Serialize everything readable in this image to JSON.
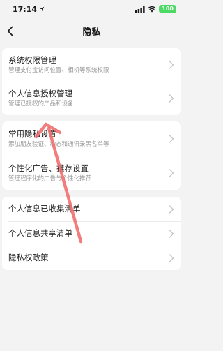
{
  "status_bar": {
    "time": "17:14",
    "battery": "100"
  },
  "nav": {
    "title": "隐私"
  },
  "sections": [
    {
      "items": [
        {
          "title": "系统权限管理",
          "subtitle": "管理支付宝访问位置、相机等系统权限"
        },
        {
          "title": "个人信息授权管理",
          "subtitle": "管理已授权的产品和设备"
        }
      ]
    },
    {
      "items": [
        {
          "title": "常用隐私设置",
          "subtitle": "添加朋友验证、动态和通讯录黑名单等"
        },
        {
          "title": "个性化广告、推荐设置",
          "subtitle": "管理程序化的广告与个性化推荐"
        }
      ]
    },
    {
      "items": [
        {
          "title": "个人信息已收集清单"
        },
        {
          "title": "个人信息共享清单"
        },
        {
          "title": "隐私权政策"
        }
      ]
    }
  ],
  "colors": {
    "annotation_arrow": "#f07070",
    "battery": "#4cd964",
    "background": "#f3f3f3"
  },
  "icons": {
    "back": "chevron-left-icon",
    "row": "chevron-right-icon",
    "location": "location-arrow-icon",
    "wifi": "wifi-icon",
    "signal": "signal-icon"
  }
}
